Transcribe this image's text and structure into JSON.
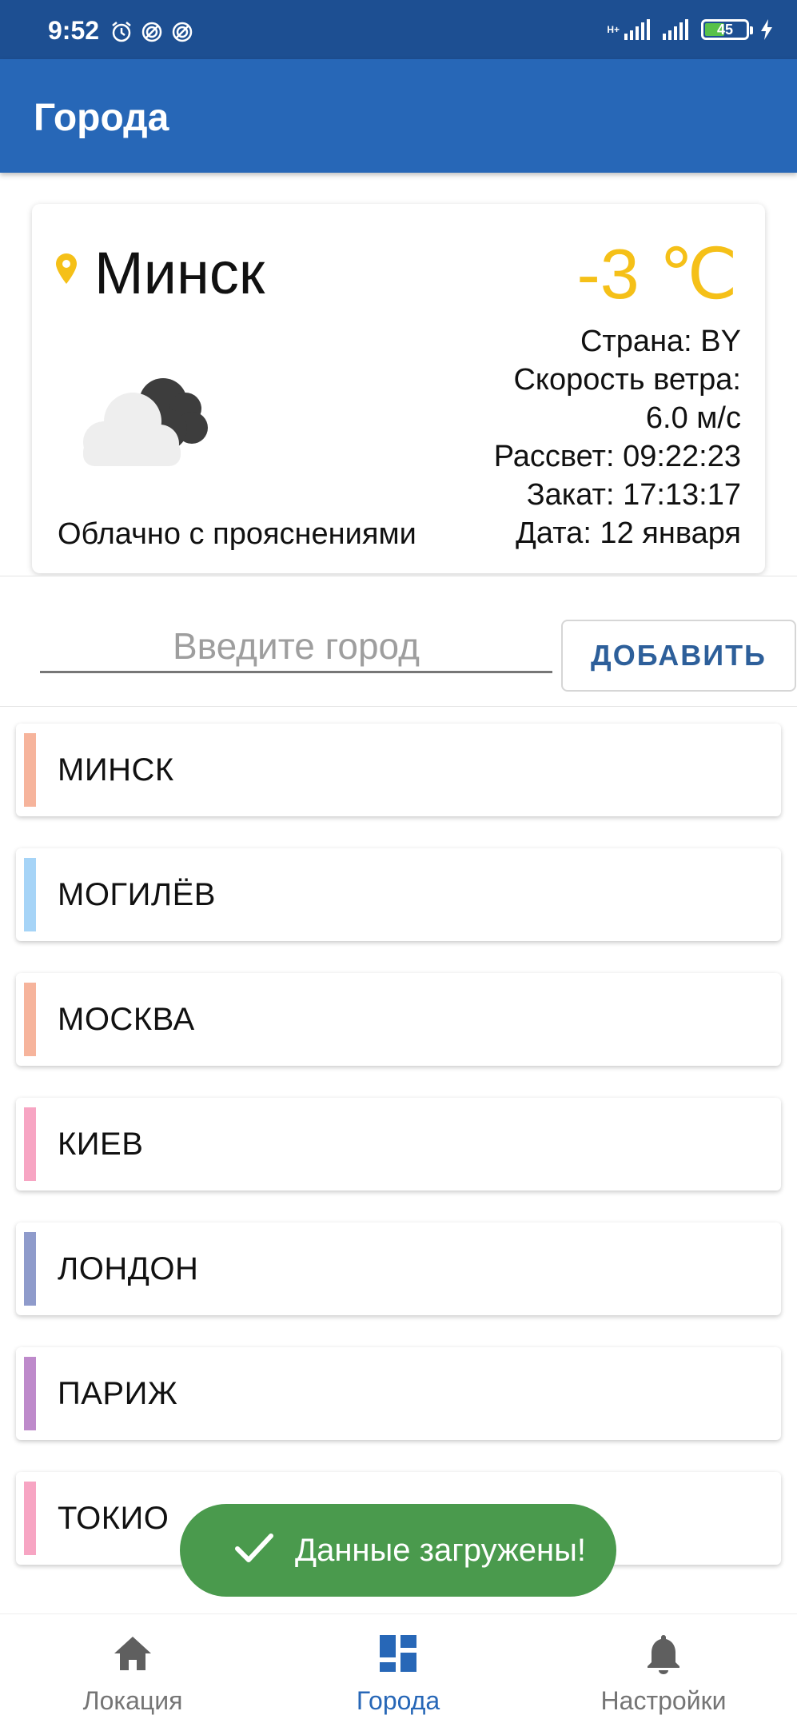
{
  "status_bar": {
    "time": "9:52",
    "network_label": "H+",
    "battery_level": "45"
  },
  "app_bar": {
    "title": "Города"
  },
  "weather": {
    "city": "Минск",
    "temperature": "-3 ℃",
    "country": "Страна: BY",
    "wind_label": "Скорость ветра:",
    "wind_value": "6.0  м/с",
    "sunrise": "Рассвет: 09:22:23",
    "sunset": "Закат: 17:13:17",
    "date": "Дата: 12 января",
    "description": "Облачно с прояснениями",
    "icon": "partly-cloudy-icon"
  },
  "add_city": {
    "placeholder": "Введите город",
    "value": "",
    "button_label": "ДОБАВИТЬ"
  },
  "cities": [
    {
      "name": "МИНСК",
      "color": "#f6b49c"
    },
    {
      "name": "МОГИЛЁВ",
      "color": "#a6d4f7"
    },
    {
      "name": "МОСКВА",
      "color": "#f6b49c"
    },
    {
      "name": "КИЕВ",
      "color": "#f7a5c3"
    },
    {
      "name": "ЛОНДОН",
      "color": "#8f9bcb"
    },
    {
      "name": "ПАРИЖ",
      "color": "#be8acb"
    },
    {
      "name": "ТОКИО",
      "color": "#f7a5c3"
    }
  ],
  "toast": {
    "text": "Данные загружены!"
  },
  "bottom_nav": [
    {
      "label": "Локация",
      "icon": "home-icon",
      "active": false
    },
    {
      "label": "Города",
      "icon": "dashboard-icon",
      "active": true
    },
    {
      "label": "Настройки",
      "icon": "bell-icon",
      "active": false
    }
  ],
  "colors": {
    "status_bar": "#1d4f92",
    "app_bar": "#2767b7",
    "temperature": "#f5c018",
    "toast": "#4a9a4d",
    "active_nav": "#2767b7"
  }
}
